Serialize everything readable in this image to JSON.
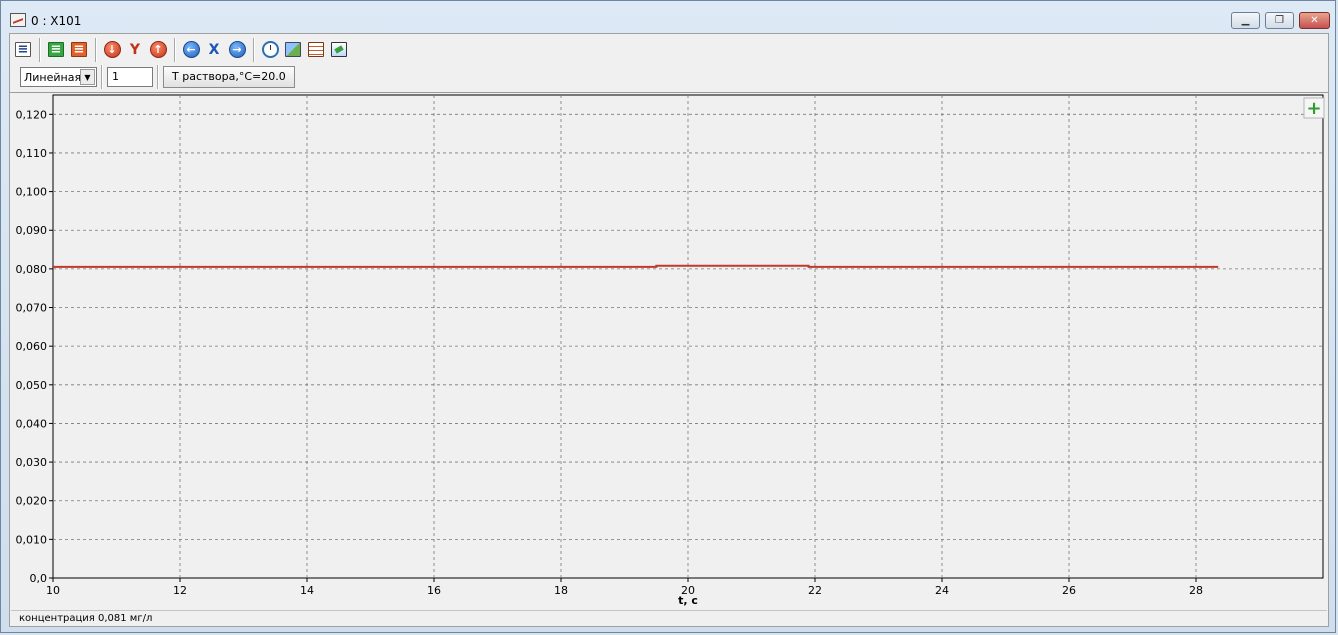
{
  "window": {
    "title": "0 : X101",
    "buttons": {
      "minimize": "▁",
      "restore": "❐",
      "close": "✕"
    }
  },
  "toolbar": {
    "icons": [
      "list-view-icon",
      "green-list-icon",
      "orange-list-icon",
      "down-arrow-icon",
      "y-axis-icon",
      "up-arrow-icon",
      "back-arrow-icon",
      "x-axis-icon",
      "forward-arrow-icon",
      "stopwatch-icon",
      "image-swap-icon",
      "table-icon",
      "picture-icon"
    ],
    "y_glyph": "Y",
    "x_glyph": "X",
    "scale_select": "Линейная",
    "channel_value": "1",
    "temperature_button": "T раствора,°C=20.0"
  },
  "chart_data": {
    "type": "line",
    "xlabel": "t, c",
    "ylabel": "",
    "xlim": [
      10,
      30
    ],
    "ylim": [
      0,
      0.125
    ],
    "x_ticks": [
      10,
      12,
      14,
      16,
      18,
      20,
      22,
      24,
      26,
      28
    ],
    "x_tick_labels": [
      "10",
      "12",
      "14",
      "16",
      "18",
      "20",
      "22",
      "24",
      "26",
      "28"
    ],
    "y_ticks": [
      0,
      0.01,
      0.02,
      0.03,
      0.04,
      0.05,
      0.06,
      0.07,
      0.08,
      0.09,
      0.1,
      0.11,
      0.12
    ],
    "y_tick_labels": [
      "0,0",
      "0,010",
      "0,020",
      "0,030",
      "0,040",
      "0,050",
      "0,060",
      "0,070",
      "0,080",
      "0,090",
      "0,100",
      "0,110",
      "0,120"
    ],
    "grid": true,
    "series": [
      {
        "color": "#c0392b",
        "x": [
          10,
          19.5,
          19.5,
          21.9,
          21.9,
          28.35
        ],
        "y": [
          0.0805,
          0.0805,
          0.0808,
          0.0808,
          0.0805,
          0.0805
        ]
      }
    ]
  },
  "add_button": "+",
  "status": {
    "text": "концентрация 0,081 мг/л"
  }
}
